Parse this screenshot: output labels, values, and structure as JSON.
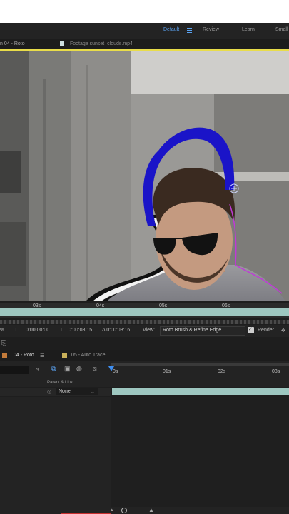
{
  "workspace": {
    "items": [
      "Default",
      "Review",
      "Learn",
      "Small"
    ],
    "active": "Default"
  },
  "panel_tabs": {
    "composition": "n 04 - Roto",
    "footage": "Footage sunset_clouds.mp4"
  },
  "viewer_ruler": {
    "labels": [
      "03s",
      "04s",
      "05s",
      "06s"
    ]
  },
  "status_bar": {
    "zoom": "%",
    "time_a": "0:00:00:00",
    "time_b": "0:00:08:15",
    "time_delta": "Δ 0:00:08:16",
    "view_label": "View:",
    "view_value": "Roto Brush & Refine Edge",
    "render_label": "Render"
  },
  "timeline_tabs": {
    "tab1": "04 - Roto",
    "tab2": "05 - Auto Trace"
  },
  "timeline_ruler": {
    "labels": [
      "0s",
      "01s",
      "02s",
      "03s"
    ]
  },
  "timeline_header": {
    "parent_link": "Parent & Link",
    "parent_value": "None"
  },
  "colors": {
    "accent_blue": "#3e8ef0",
    "track_teal": "#9ec7c0",
    "comp_yellow": "#e8dc4a",
    "roto_blue": "#1a14c8",
    "roto_outline": "#c038d8"
  }
}
